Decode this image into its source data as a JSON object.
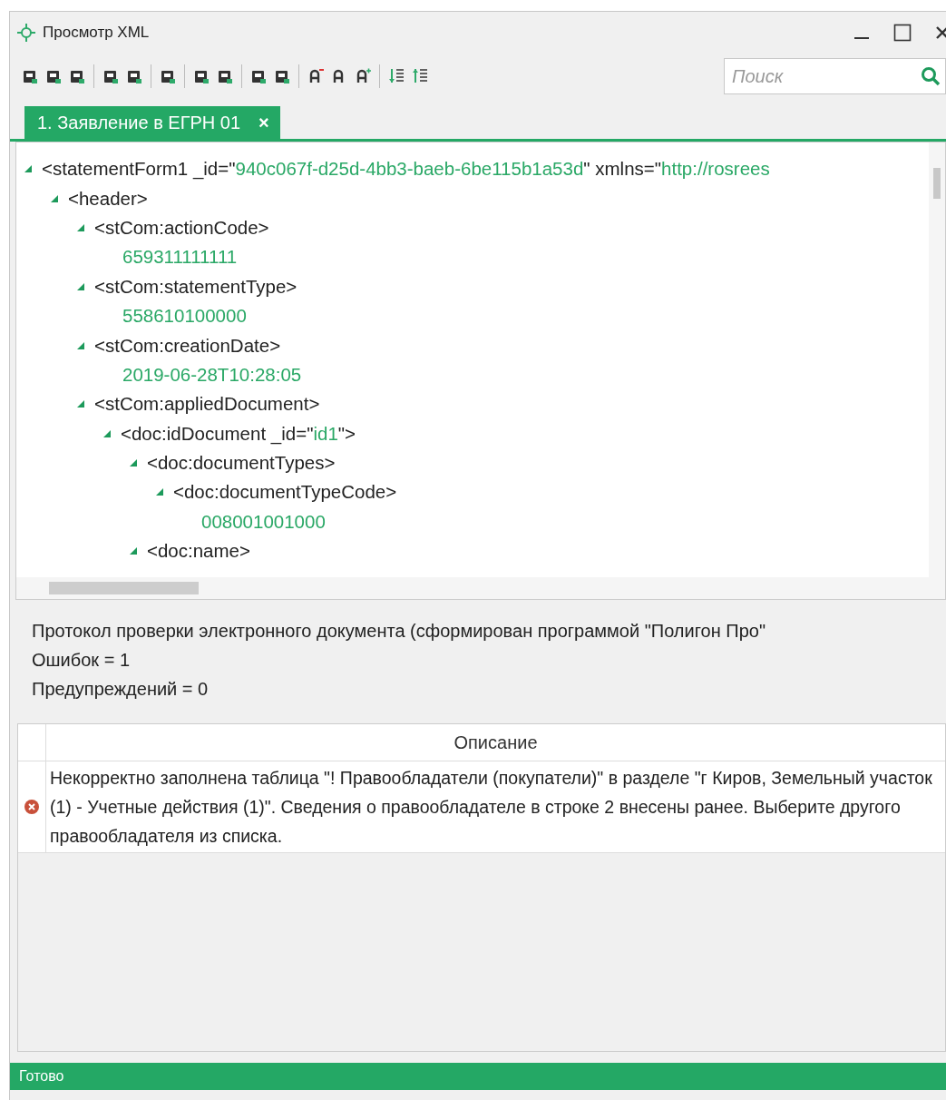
{
  "window": {
    "title": "Просмотр XML"
  },
  "search": {
    "placeholder": "Поиск"
  },
  "tabs": [
    {
      "label": "1. Заявление в ЕГРН 01",
      "close": "×",
      "selected": true
    }
  ],
  "xml_view": {
    "nodes": [
      {
        "kind": "element",
        "expanded": true,
        "parts": [
          {
            "kind": "markup",
            "text": "<statementForm1 _id=\""
          },
          {
            "kind": "value",
            "text": "940c067f-d25d-4bb3-baeb-6be115b1a53d"
          },
          {
            "kind": "markup",
            "text": "\" xmlns=\""
          },
          {
            "kind": "value",
            "text": "http://rosrees"
          }
        ],
        "children": [
          {
            "kind": "element",
            "expanded": true,
            "parts": [
              {
                "kind": "markup",
                "text": "<header>"
              }
            ],
            "children": [
              {
                "kind": "element",
                "expanded": true,
                "parts": [
                  {
                    "kind": "markup",
                    "text": "<stCom:actionCode>"
                  }
                ],
                "children": [
                  {
                    "kind": "value",
                    "text": "659311111111"
                  }
                ]
              },
              {
                "kind": "element",
                "expanded": true,
                "parts": [
                  {
                    "kind": "markup",
                    "text": "<stCom:statementType>"
                  }
                ],
                "children": [
                  {
                    "kind": "value",
                    "text": "558610100000"
                  }
                ]
              },
              {
                "kind": "element",
                "expanded": true,
                "parts": [
                  {
                    "kind": "markup",
                    "text": "<stCom:creationDate>"
                  }
                ],
                "children": [
                  {
                    "kind": "value",
                    "text": "2019-06-28T10:28:05"
                  }
                ]
              },
              {
                "kind": "element",
                "expanded": true,
                "parts": [
                  {
                    "kind": "markup",
                    "text": "<stCom:appliedDocument>"
                  }
                ],
                "children": [
                  {
                    "kind": "element",
                    "expanded": true,
                    "parts": [
                      {
                        "kind": "markup",
                        "text": "<doc:idDocument _id=\""
                      },
                      {
                        "kind": "value",
                        "text": "id1"
                      },
                      {
                        "kind": "markup",
                        "text": "\">"
                      }
                    ],
                    "children": [
                      {
                        "kind": "element",
                        "expanded": true,
                        "parts": [
                          {
                            "kind": "markup",
                            "text": "<doc:documentTypes>"
                          }
                        ],
                        "children": [
                          {
                            "kind": "element",
                            "expanded": true,
                            "parts": [
                              {
                                "kind": "markup",
                                "text": "<doc:documentTypeCode>"
                              }
                            ],
                            "children": [
                              {
                                "kind": "value",
                                "text": "008001001000"
                              }
                            ]
                          }
                        ]
                      },
                      {
                        "kind": "element",
                        "expanded": true,
                        "parts": [
                          {
                            "kind": "markup",
                            "text": "<doc:name>"
                          }
                        ]
                      }
                    ]
                  }
                ]
              }
            ]
          }
        ]
      }
    ]
  },
  "protocol": {
    "lines": [
      "Протокол проверки электронного документа (сформирован программой \"Полигон Про\"",
      "Ошибок = 1",
      "Предупреждений = 0"
    ]
  },
  "table": {
    "columns": [
      "Описание"
    ],
    "rows": [
      {
        "kind": "error",
        "text": "Некорректно заполнена таблица \"! Правообладатели (покупатели)\" в разделе \"г Киров, Земельный участок (1) - Учетные действия (1)\". Сведения о правообладателе в строке 2 внесены ранее. Выберите другого правообладателя из списка."
      }
    ]
  },
  "status_bar": {
    "text": "Готово"
  }
}
